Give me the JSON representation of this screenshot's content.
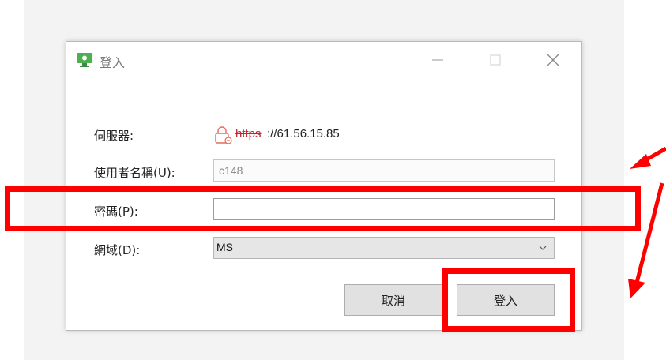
{
  "window": {
    "title": "登入",
    "controls": [
      "minimize",
      "maximize",
      "close"
    ]
  },
  "form": {
    "server": {
      "label": "伺服器:",
      "scheme": "https",
      "host": "://61.56.15.85",
      "icon": "broken-lock-icon"
    },
    "username": {
      "label": "使用者名稱(U):",
      "value": "c148"
    },
    "password": {
      "label": "密碼(P):",
      "value": ""
    },
    "domain": {
      "label": "網域(D):",
      "value": "MS"
    }
  },
  "buttons": {
    "cancel": "取消",
    "login": "登入"
  },
  "annotations": {
    "color": "#ff0000",
    "highlights": [
      "password-field",
      "login-button"
    ]
  }
}
